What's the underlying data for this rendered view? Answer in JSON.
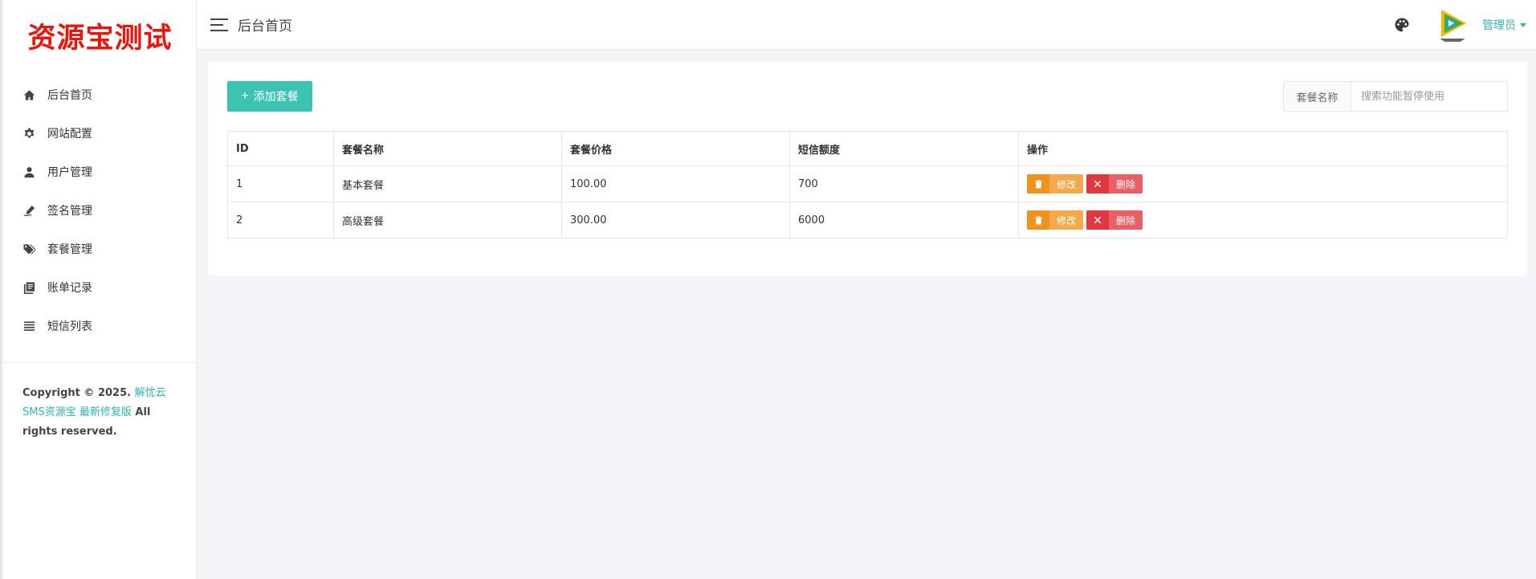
{
  "brand": {
    "logo_text": "资源宝测试",
    "logo_color": "#e8160c"
  },
  "sidebar": {
    "items": [
      {
        "label": "后台首页",
        "icon": "home-icon"
      },
      {
        "label": "网站配置",
        "icon": "gear-icon"
      },
      {
        "label": "用户管理",
        "icon": "user-icon"
      },
      {
        "label": "签名管理",
        "icon": "signature-icon"
      },
      {
        "label": "套餐管理",
        "icon": "tags-icon"
      },
      {
        "label": "账单记录",
        "icon": "book-icon"
      },
      {
        "label": "短信列表",
        "icon": "list-icon"
      }
    ],
    "copyright": {
      "prefix": "Copyright © 2025. ",
      "link": "解忧云SMS资源宝 最新修复版",
      "suffix": " All rights reserved."
    }
  },
  "topbar": {
    "title": "后台首页",
    "user_label": "管理员",
    "accent_color": "#2bb8a8"
  },
  "toolbar": {
    "add_label": "添加套餐",
    "search_label": "套餐名称",
    "search_placeholder": "搜索功能暂停使用"
  },
  "table": {
    "headers": [
      "ID",
      "套餐名称",
      "套餐价格",
      "短信额度",
      "操作"
    ],
    "rows": [
      {
        "id": "1",
        "name": "基本套餐",
        "price": "100.00",
        "quota": "700"
      },
      {
        "id": "2",
        "name": "高级套餐",
        "price": "300.00",
        "quota": "6000"
      }
    ],
    "edit_label": "修改",
    "delete_label": "删除"
  }
}
